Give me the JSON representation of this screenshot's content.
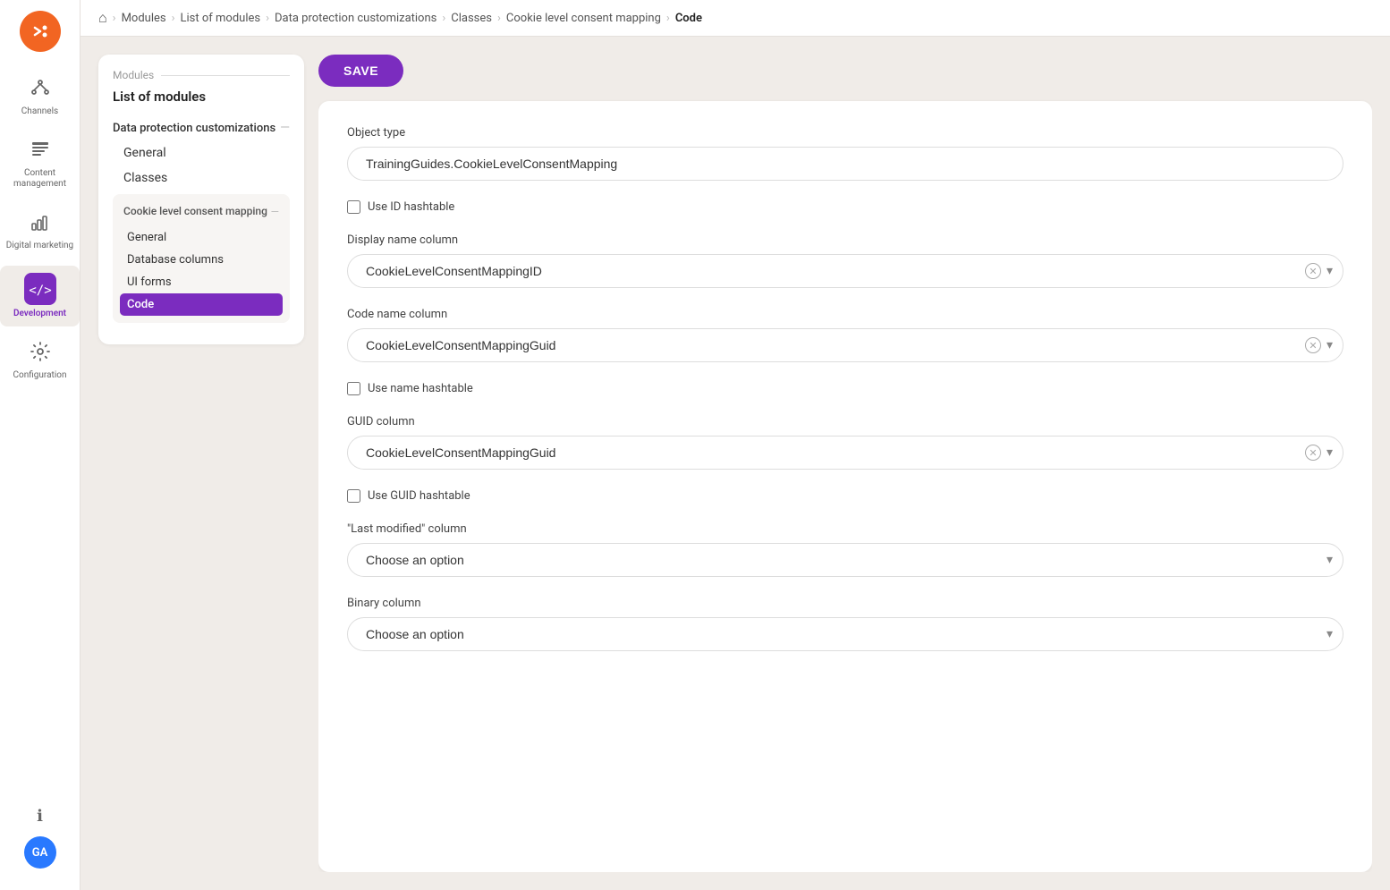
{
  "logo": {
    "alt": "Kentico logo"
  },
  "sidebar": {
    "items": [
      {
        "id": "channels",
        "label": "Channels",
        "icon": "channels"
      },
      {
        "id": "content-management",
        "label": "Content management",
        "icon": "content"
      },
      {
        "id": "digital-marketing",
        "label": "Digital marketing",
        "icon": "marketing"
      },
      {
        "id": "development",
        "label": "Development",
        "icon": "dev",
        "active": true
      },
      {
        "id": "configuration",
        "label": "Configuration",
        "icon": "config"
      }
    ],
    "bottom": {
      "info_icon": "ℹ",
      "avatar_initials": "GA"
    }
  },
  "breadcrumb": {
    "home": "🏠",
    "items": [
      "Modules",
      "List of modules",
      "Data protection customizations",
      "Classes",
      "Cookie level consent mapping",
      "Code"
    ]
  },
  "left_panel": {
    "section_label": "Modules",
    "list_title": "List of modules",
    "nav": {
      "section_label": "Data protection customizations",
      "items": [
        "General",
        "Classes"
      ],
      "subsection": {
        "label": "Cookie level consent mapping",
        "items": [
          "General",
          "Database columns",
          "UI forms",
          "Code"
        ]
      }
    }
  },
  "toolbar": {
    "save_label": "SAVE"
  },
  "form": {
    "object_type_label": "Object type",
    "object_type_value": "TrainingGuides.CookieLevelConsentMapping",
    "use_id_hashtable_label": "Use ID hashtable",
    "display_name_label": "Display name column",
    "display_name_value": "CookieLevelConsentMappingID",
    "code_name_label": "Code name column",
    "code_name_value": "CookieLevelConsentMappingGuid",
    "use_name_hashtable_label": "Use name hashtable",
    "guid_label": "GUID column",
    "guid_value": "CookieLevelConsentMappingGuid",
    "use_guid_hashtable_label": "Use GUID hashtable",
    "last_modified_label": "\"Last modified\" column",
    "last_modified_placeholder": "Choose an option",
    "binary_label": "Binary column",
    "binary_placeholder": "Choose an option"
  }
}
